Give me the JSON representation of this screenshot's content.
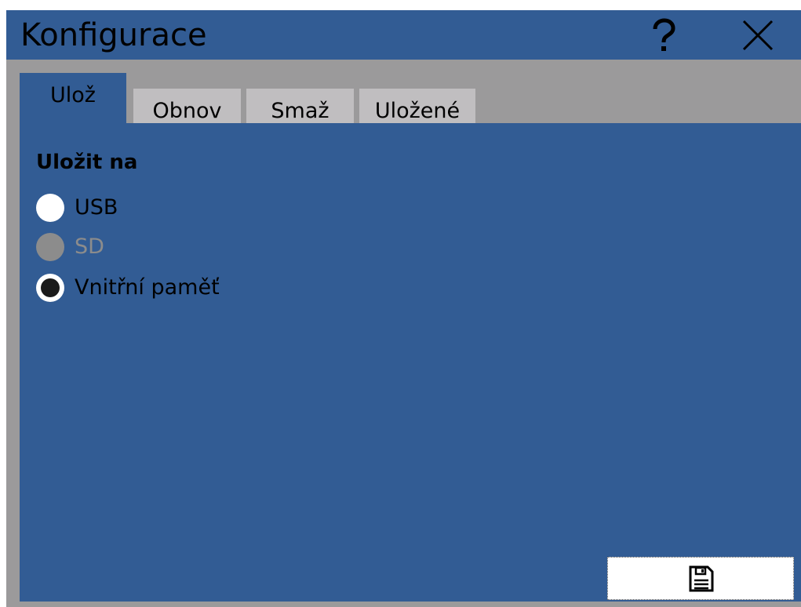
{
  "window": {
    "title": "Konfigurace",
    "help_icon": "question-mark-icon",
    "close_icon": "close-x-icon"
  },
  "tabs": [
    {
      "label": "Ulož",
      "active": true
    },
    {
      "label": "Obnov",
      "active": false
    },
    {
      "label": "Smaž",
      "active": false
    },
    {
      "label": "Uložené",
      "active": false
    }
  ],
  "save_panel": {
    "section_title": "Uložit na",
    "options": [
      {
        "label": "USB",
        "state": "unchecked",
        "enabled": true
      },
      {
        "label": "SD",
        "state": "unchecked",
        "enabled": false
      },
      {
        "label": "Vnitřní paměť",
        "state": "checked",
        "enabled": true
      }
    ],
    "save_button_icon": "floppy-disk-icon"
  },
  "colors": {
    "panel_blue": "#325c94",
    "frame_gray": "#9b9a9b",
    "inactive_tab": "#c0bec0",
    "disabled_gray": "#8c8c8c"
  }
}
